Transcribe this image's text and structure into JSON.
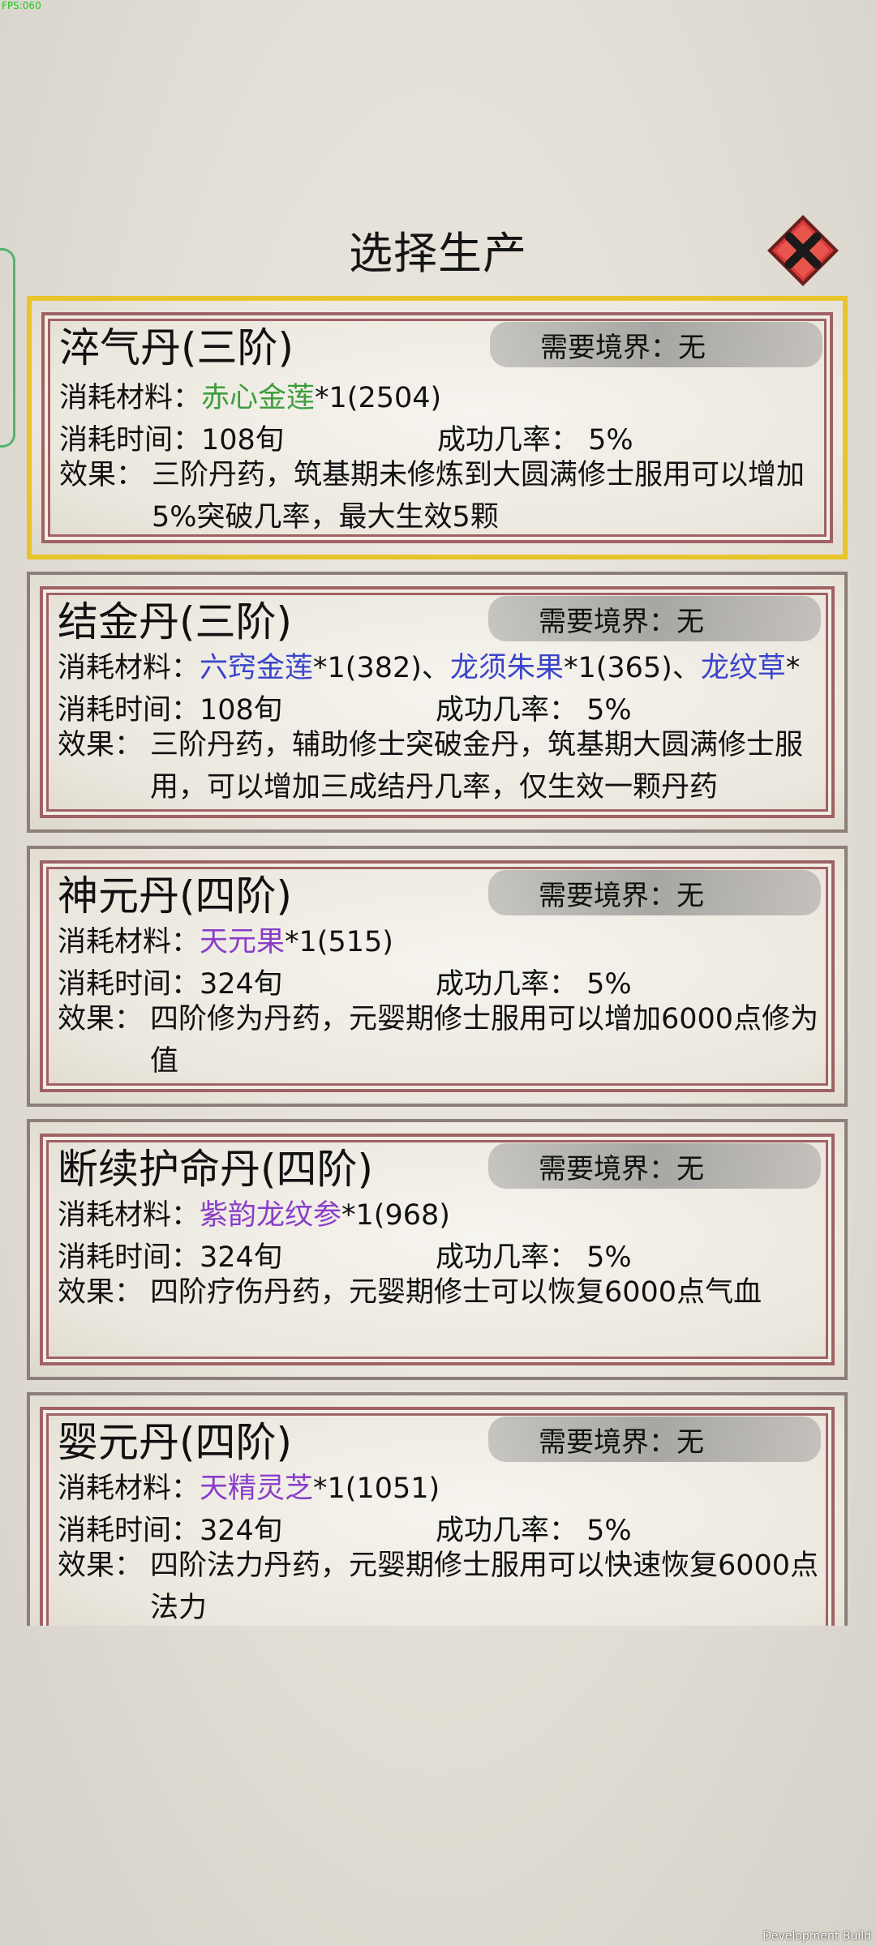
{
  "overlay": {
    "fps": "FPS:060",
    "build": "Development Build"
  },
  "header": {
    "title": "选择生产"
  },
  "labels": {
    "realm": "需要境界：",
    "materials": "消耗材料：",
    "time": "消耗时间：",
    "rate": "成功几率：",
    "effect": "效果："
  },
  "recipes": [
    {
      "name": "淬气丹(三阶)",
      "realm": "无",
      "materials": [
        {
          "name": "赤心金莲",
          "qty": "*1(2504)",
          "color": "#3e9d3e"
        }
      ],
      "time": "108旬",
      "rate": "5%",
      "effect": "三阶丹药，筑基期未修炼到大圆满修士服用可以增加5%突破几率，最大生效5颗"
    },
    {
      "name": "结金丹(三阶)",
      "realm": "无",
      "materials": [
        {
          "name": "六窍金莲",
          "qty": "*1(382)、",
          "color": "#3b45c9"
        },
        {
          "name": "龙须朱果",
          "qty": "*1(365)、",
          "color": "#3b45c9"
        },
        {
          "name": "龙纹草",
          "qty": "*",
          "color": "#3b45c9"
        }
      ],
      "time": "108旬",
      "rate": "5%",
      "effect": "三阶丹药，辅助修士突破金丹，筑基期大圆满修士服用，可以增加三成结丹几率，仅生效一颗丹药"
    },
    {
      "name": "神元丹(四阶)",
      "realm": "无",
      "materials": [
        {
          "name": "天元果",
          "qty": "*1(515)",
          "color": "#8a3ec8"
        }
      ],
      "time": "324旬",
      "rate": "5%",
      "effect": "四阶修为丹药，元婴期修士服用可以增加6000点修为值"
    },
    {
      "name": "断续护命丹(四阶)",
      "realm": "无",
      "materials": [
        {
          "name": "紫韵龙纹参",
          "qty": "*1(968)",
          "color": "#8a3ec8"
        }
      ],
      "time": "324旬",
      "rate": "5%",
      "effect": "四阶疗伤丹药，元婴期修士可以恢复6000点气血"
    },
    {
      "name": "婴元丹(四阶)",
      "realm": "无",
      "materials": [
        {
          "name": "天精灵芝",
          "qty": "*1(1051)",
          "color": "#8a3ec8"
        }
      ],
      "time": "324旬",
      "rate": "5%",
      "effect": "四阶法力丹药，元婴期修士服用可以快速恢复6000点法力"
    }
  ]
}
